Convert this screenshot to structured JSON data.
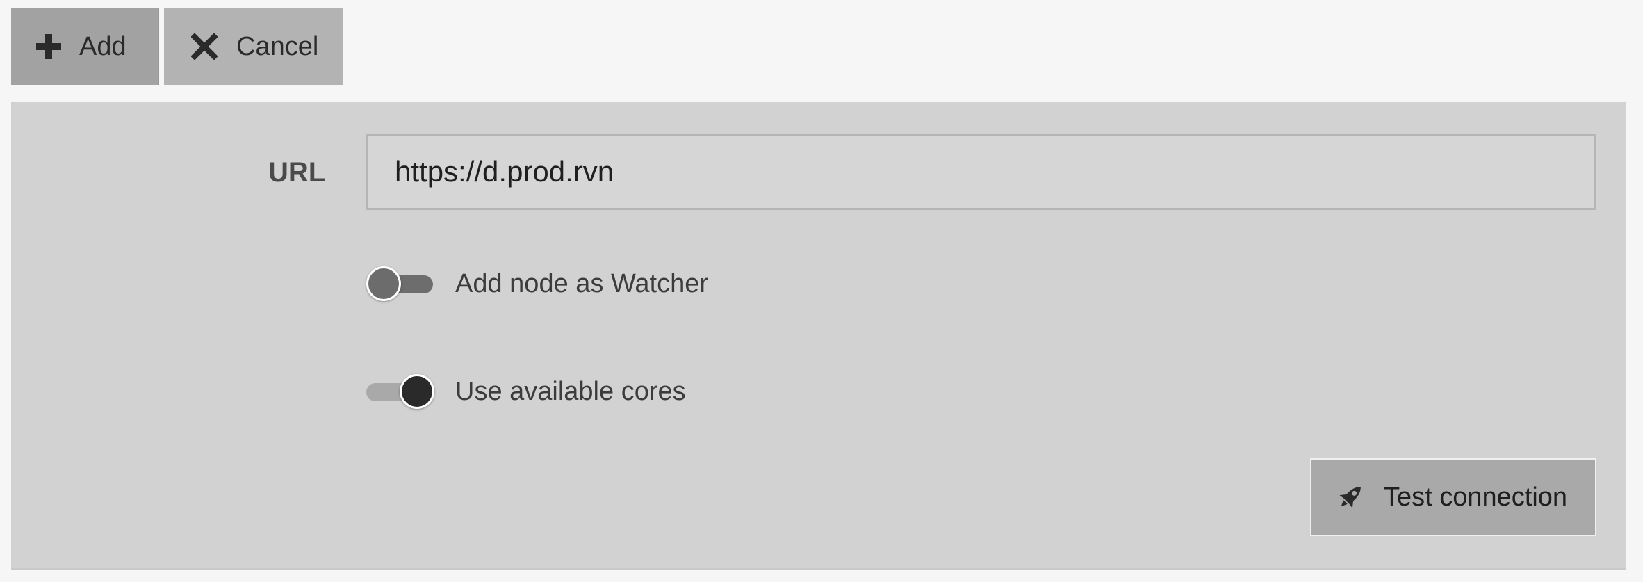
{
  "toolbar": {
    "add_label": "Add",
    "add_icon": "plus-icon",
    "cancel_label": "Cancel",
    "cancel_icon": "close-icon"
  },
  "form": {
    "url_label": "URL",
    "url_value": "https://d.prod.rvn",
    "watcher_toggle": {
      "label": "Add node as Watcher",
      "checked": false
    },
    "cores_toggle": {
      "label": "Use available cores",
      "checked": true
    },
    "test_button": {
      "label": "Test connection",
      "icon": "rocket-icon"
    }
  },
  "colors": {
    "page_background": "#f6f6f6",
    "panel_background": "#d2d2d2",
    "button_gray": "#a9a9a9",
    "toggle_on_knob": "#2a2a2a",
    "toggle_off_knob": "#6c6c6c"
  }
}
